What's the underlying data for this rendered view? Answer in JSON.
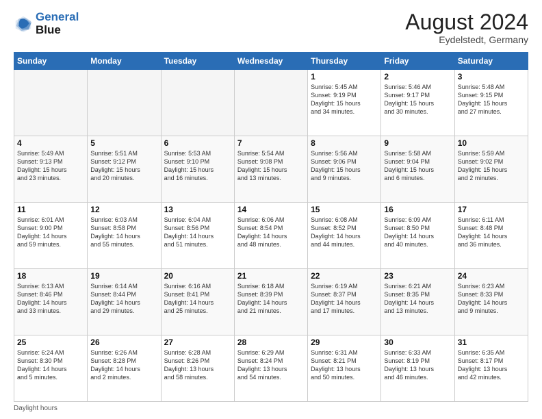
{
  "header": {
    "logo_line1": "General",
    "logo_line2": "Blue",
    "month_title": "August 2024",
    "location": "Eydelstedt, Germany"
  },
  "footer": {
    "note": "Daylight hours"
  },
  "days_of_week": [
    "Sunday",
    "Monday",
    "Tuesday",
    "Wednesday",
    "Thursday",
    "Friday",
    "Saturday"
  ],
  "weeks": [
    [
      {
        "day": "",
        "info": ""
      },
      {
        "day": "",
        "info": ""
      },
      {
        "day": "",
        "info": ""
      },
      {
        "day": "",
        "info": ""
      },
      {
        "day": "1",
        "info": "Sunrise: 5:45 AM\nSunset: 9:19 PM\nDaylight: 15 hours\nand 34 minutes."
      },
      {
        "day": "2",
        "info": "Sunrise: 5:46 AM\nSunset: 9:17 PM\nDaylight: 15 hours\nand 30 minutes."
      },
      {
        "day": "3",
        "info": "Sunrise: 5:48 AM\nSunset: 9:15 PM\nDaylight: 15 hours\nand 27 minutes."
      }
    ],
    [
      {
        "day": "4",
        "info": "Sunrise: 5:49 AM\nSunset: 9:13 PM\nDaylight: 15 hours\nand 23 minutes."
      },
      {
        "day": "5",
        "info": "Sunrise: 5:51 AM\nSunset: 9:12 PM\nDaylight: 15 hours\nand 20 minutes."
      },
      {
        "day": "6",
        "info": "Sunrise: 5:53 AM\nSunset: 9:10 PM\nDaylight: 15 hours\nand 16 minutes."
      },
      {
        "day": "7",
        "info": "Sunrise: 5:54 AM\nSunset: 9:08 PM\nDaylight: 15 hours\nand 13 minutes."
      },
      {
        "day": "8",
        "info": "Sunrise: 5:56 AM\nSunset: 9:06 PM\nDaylight: 15 hours\nand 9 minutes."
      },
      {
        "day": "9",
        "info": "Sunrise: 5:58 AM\nSunset: 9:04 PM\nDaylight: 15 hours\nand 6 minutes."
      },
      {
        "day": "10",
        "info": "Sunrise: 5:59 AM\nSunset: 9:02 PM\nDaylight: 15 hours\nand 2 minutes."
      }
    ],
    [
      {
        "day": "11",
        "info": "Sunrise: 6:01 AM\nSunset: 9:00 PM\nDaylight: 14 hours\nand 59 minutes."
      },
      {
        "day": "12",
        "info": "Sunrise: 6:03 AM\nSunset: 8:58 PM\nDaylight: 14 hours\nand 55 minutes."
      },
      {
        "day": "13",
        "info": "Sunrise: 6:04 AM\nSunset: 8:56 PM\nDaylight: 14 hours\nand 51 minutes."
      },
      {
        "day": "14",
        "info": "Sunrise: 6:06 AM\nSunset: 8:54 PM\nDaylight: 14 hours\nand 48 minutes."
      },
      {
        "day": "15",
        "info": "Sunrise: 6:08 AM\nSunset: 8:52 PM\nDaylight: 14 hours\nand 44 minutes."
      },
      {
        "day": "16",
        "info": "Sunrise: 6:09 AM\nSunset: 8:50 PM\nDaylight: 14 hours\nand 40 minutes."
      },
      {
        "day": "17",
        "info": "Sunrise: 6:11 AM\nSunset: 8:48 PM\nDaylight: 14 hours\nand 36 minutes."
      }
    ],
    [
      {
        "day": "18",
        "info": "Sunrise: 6:13 AM\nSunset: 8:46 PM\nDaylight: 14 hours\nand 33 minutes."
      },
      {
        "day": "19",
        "info": "Sunrise: 6:14 AM\nSunset: 8:44 PM\nDaylight: 14 hours\nand 29 minutes."
      },
      {
        "day": "20",
        "info": "Sunrise: 6:16 AM\nSunset: 8:41 PM\nDaylight: 14 hours\nand 25 minutes."
      },
      {
        "day": "21",
        "info": "Sunrise: 6:18 AM\nSunset: 8:39 PM\nDaylight: 14 hours\nand 21 minutes."
      },
      {
        "day": "22",
        "info": "Sunrise: 6:19 AM\nSunset: 8:37 PM\nDaylight: 14 hours\nand 17 minutes."
      },
      {
        "day": "23",
        "info": "Sunrise: 6:21 AM\nSunset: 8:35 PM\nDaylight: 14 hours\nand 13 minutes."
      },
      {
        "day": "24",
        "info": "Sunrise: 6:23 AM\nSunset: 8:33 PM\nDaylight: 14 hours\nand 9 minutes."
      }
    ],
    [
      {
        "day": "25",
        "info": "Sunrise: 6:24 AM\nSunset: 8:30 PM\nDaylight: 14 hours\nand 5 minutes."
      },
      {
        "day": "26",
        "info": "Sunrise: 6:26 AM\nSunset: 8:28 PM\nDaylight: 14 hours\nand 2 minutes."
      },
      {
        "day": "27",
        "info": "Sunrise: 6:28 AM\nSunset: 8:26 PM\nDaylight: 13 hours\nand 58 minutes."
      },
      {
        "day": "28",
        "info": "Sunrise: 6:29 AM\nSunset: 8:24 PM\nDaylight: 13 hours\nand 54 minutes."
      },
      {
        "day": "29",
        "info": "Sunrise: 6:31 AM\nSunset: 8:21 PM\nDaylight: 13 hours\nand 50 minutes."
      },
      {
        "day": "30",
        "info": "Sunrise: 6:33 AM\nSunset: 8:19 PM\nDaylight: 13 hours\nand 46 minutes."
      },
      {
        "day": "31",
        "info": "Sunrise: 6:35 AM\nSunset: 8:17 PM\nDaylight: 13 hours\nand 42 minutes."
      }
    ]
  ]
}
